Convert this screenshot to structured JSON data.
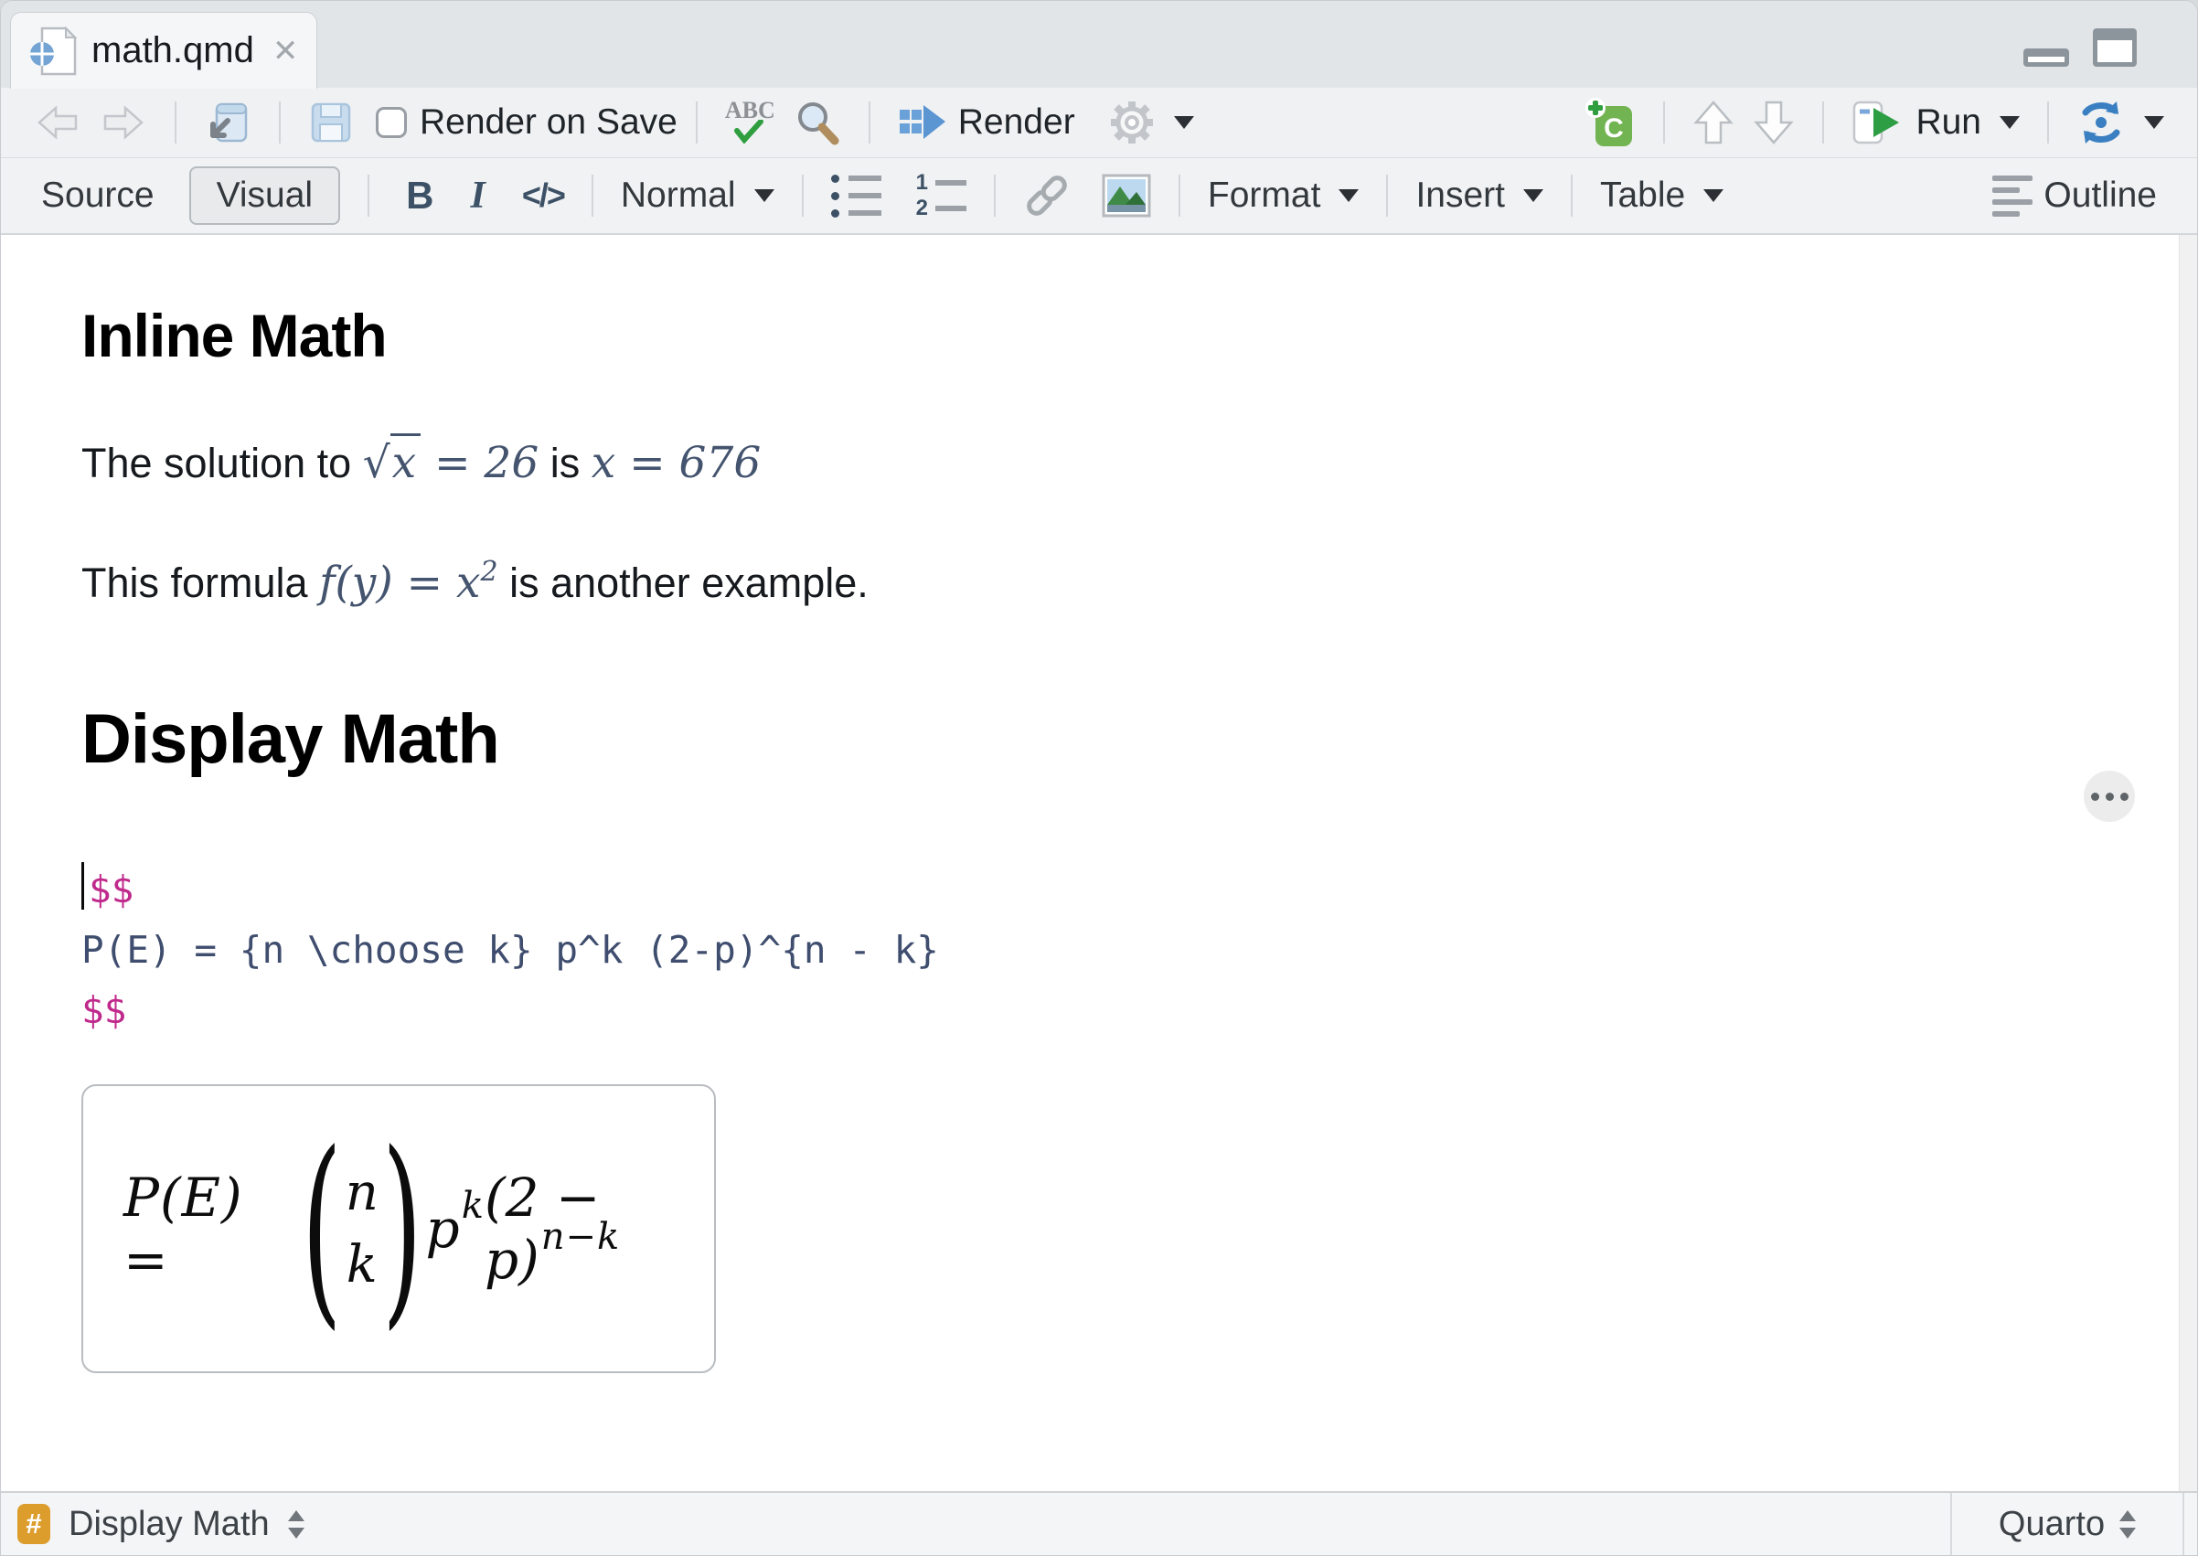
{
  "tab": {
    "title": "math.qmd",
    "close_icon": "✕"
  },
  "toolbar": {
    "render_on_save": "Render on Save",
    "spellcheck_icon_text": "ABC",
    "render": "Render",
    "chunk_icon_text": "C",
    "run": "Run"
  },
  "formatbar": {
    "source": "Source",
    "visual": "Visual",
    "bold_icon_text": "B",
    "italic_icon_text": "I",
    "code_icon_text": "</>",
    "style": "Normal",
    "numbered_icon_1": "1",
    "numbered_icon_2": "2",
    "format": "Format",
    "insert": "Insert",
    "table": "Table",
    "outline": "Outline"
  },
  "doc": {
    "h_inline": "Inline Math",
    "p1": {
      "t1": "The solution to ",
      "radical": "√",
      "radicand": "x",
      "m1": " = 26",
      "t2": " is ",
      "m2": "x = 676"
    },
    "p2": {
      "t1": "This formula ",
      "m1": "f(y) = x",
      "sup": "2",
      "t2": " is another example."
    },
    "h_display": "Display Math",
    "code": {
      "l1": "$$",
      "l2": "P(E) = {n \\choose k} p^k (2-p)^{n - k}",
      "l3": "$$"
    },
    "eq": {
      "lhs": "P(E) =",
      "open_paren": "(",
      "top": "n",
      "bottom": "k",
      "close_paren": ")",
      "b1": "p",
      "s1": "k",
      "b2": "(2 − p)",
      "s2": "n−k"
    }
  },
  "statusbar": {
    "hash": "#",
    "left": "Display Math",
    "right": "Quarto"
  },
  "colors": {
    "magenta": "#c0298c",
    "code_blue": "#3f4d6e",
    "math_blue": "#44546e",
    "badge_orange": "#dc9d2c",
    "run_green": "#2e9e44",
    "icon_navy": "#3d5166",
    "quarto_blue": "#73a4d4"
  }
}
